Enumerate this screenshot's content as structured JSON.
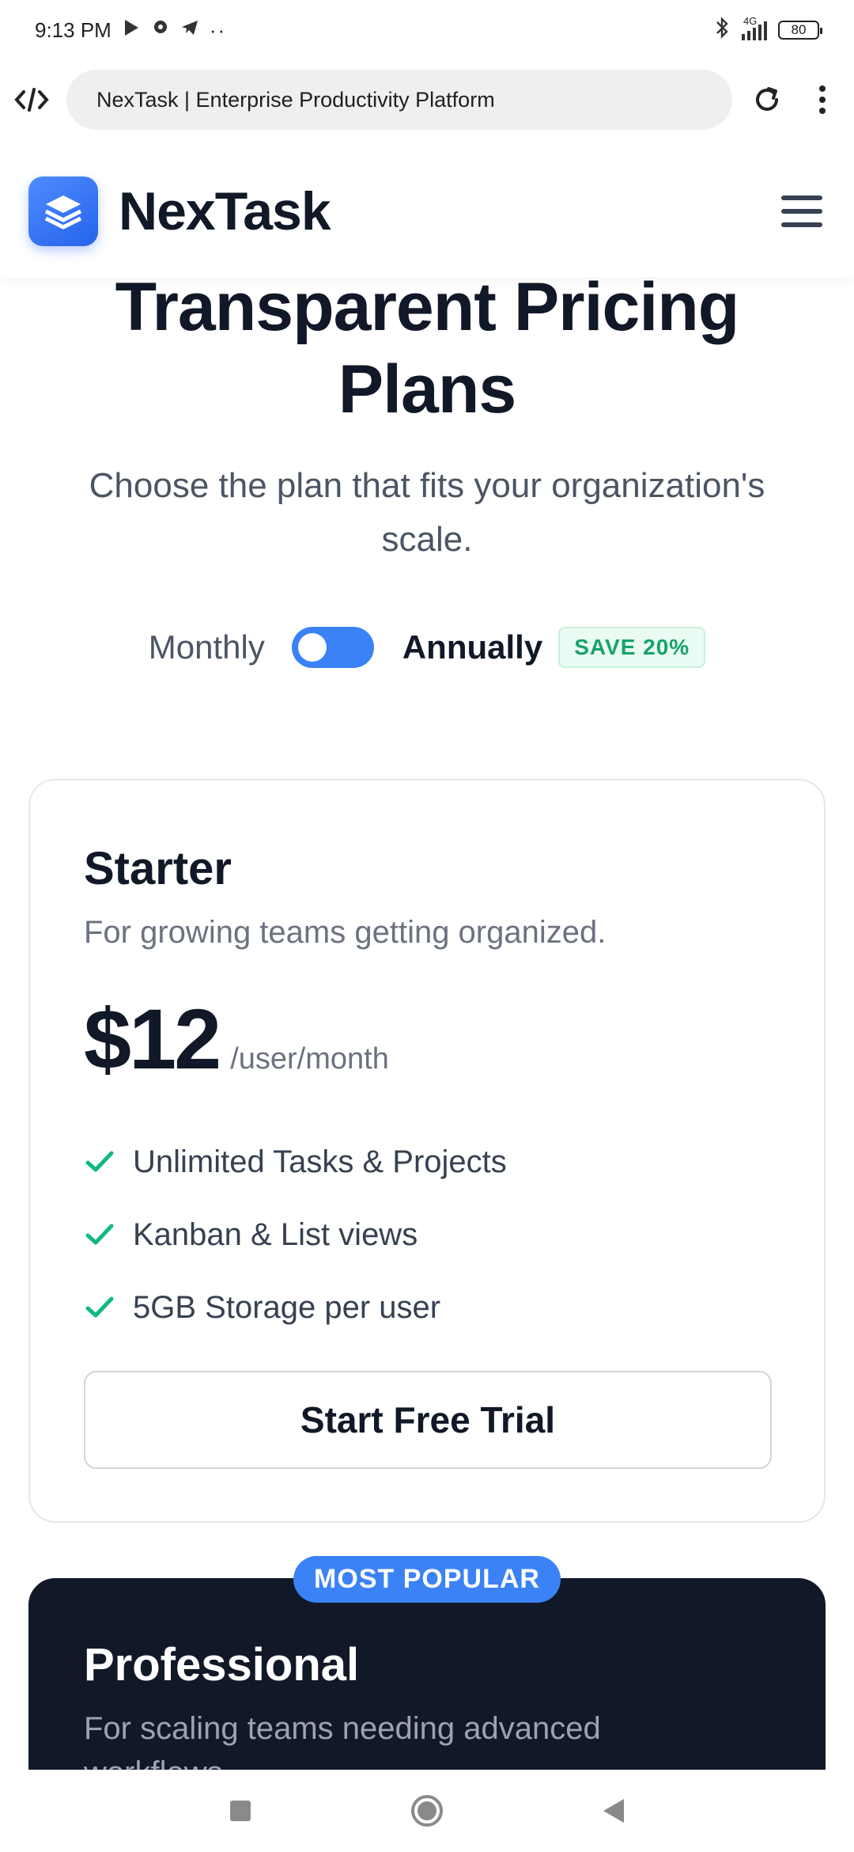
{
  "status_bar": {
    "time": "9:13 PM",
    "network": "4G",
    "battery": "80"
  },
  "browser": {
    "url_title": "NexTask | Enterprise Productivity Platform"
  },
  "header": {
    "brand": "NexTask"
  },
  "hero": {
    "title_line1": "Transparent Pricing",
    "title_line2": "Plans",
    "subtitle": "Choose the plan that fits your organization's scale."
  },
  "billing": {
    "monthly_label": "Monthly",
    "annual_label": "Annually",
    "save_badge": "SAVE 20%"
  },
  "plans": [
    {
      "name": "Starter",
      "description": "For growing teams getting organized.",
      "price": "$12",
      "period": "/user/month",
      "features": [
        "Unlimited Tasks & Projects",
        "Kanban & List views",
        "5GB Storage per user"
      ],
      "cta": "Start Free Trial"
    },
    {
      "badge": "MOST POPULAR",
      "name": "Professional",
      "description": "For scaling teams needing advanced workflows."
    }
  ],
  "colors": {
    "accent": "#3b82f6",
    "check_green": "#10b981",
    "badge_green": "#16a36a",
    "dark_card": "#111827"
  }
}
